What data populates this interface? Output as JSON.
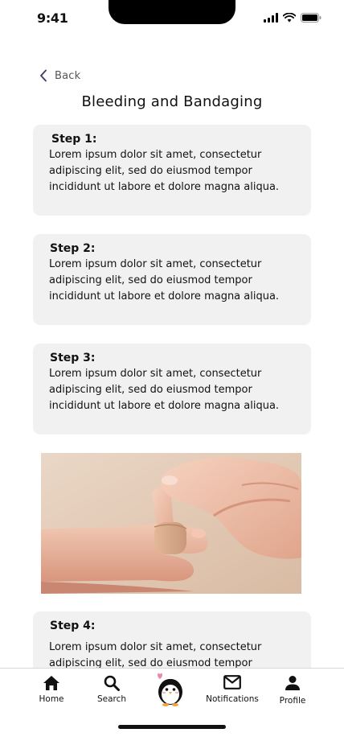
{
  "status_bar": {
    "time": "9:41"
  },
  "header": {
    "back_label": "Back",
    "title": "Bleeding and Bandaging"
  },
  "steps": [
    {
      "title": "Step 1:",
      "text": "Lorem ipsum dolor sit amet, consectetur adipiscing elit, sed do eiusmod tempor incididunt ut labore et dolore magna aliqua."
    },
    {
      "title": "Step 2:",
      "text": "Lorem ipsum dolor sit amet, consectetur adipiscing elit, sed do eiusmod tempor incididunt ut labore et dolore magna aliqua."
    },
    {
      "title": "Step 3:",
      "text": "Lorem ipsum dolor sit amet, consectetur adipiscing elit, sed do eiusmod tempor incididunt ut labore et dolore magna aliqua."
    },
    {
      "title": "Step 4:",
      "text": "Lorem ipsum dolor sit amet, consectetur adipiscing elit, sed do eiusmod tempor incididunt ut labore et dolore magna aliqua."
    }
  ],
  "image": {
    "icon": "bandaged-finger-photo"
  },
  "nav": {
    "items": [
      {
        "label": "Home",
        "icon": "home-icon"
      },
      {
        "label": "Search",
        "icon": "search-icon"
      },
      {
        "label": "",
        "icon": "penguin-mascot-icon"
      },
      {
        "label": "Notifications",
        "icon": "mail-icon"
      },
      {
        "label": "Profile",
        "icon": "profile-icon"
      }
    ]
  }
}
